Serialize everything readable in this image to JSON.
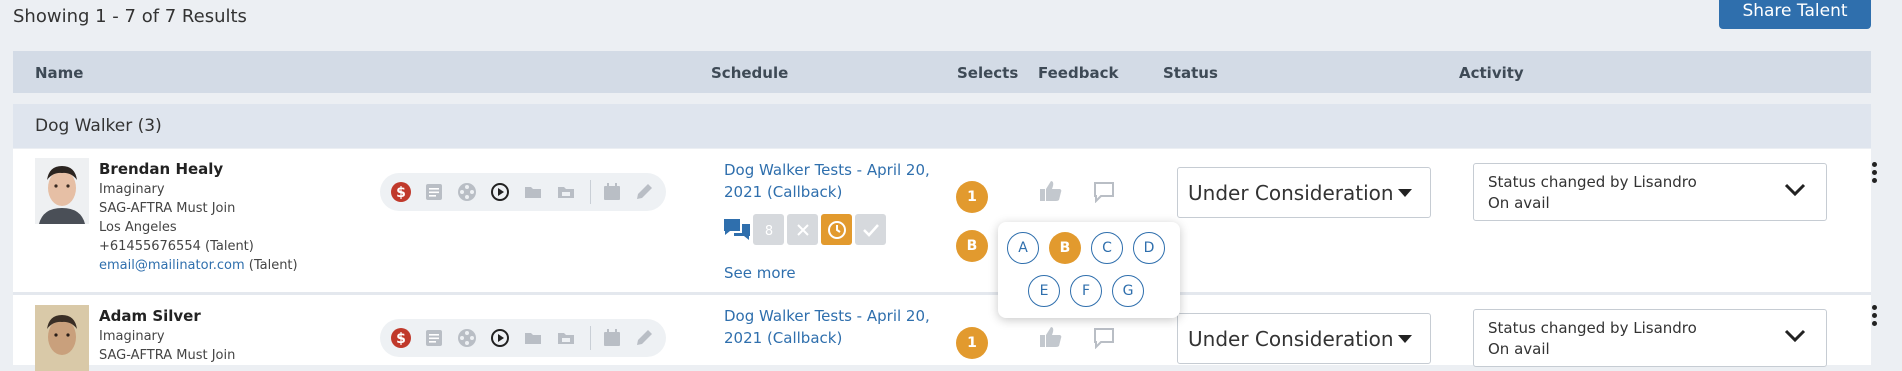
{
  "results_count": "Showing 1 - 7 of 7 Results",
  "share_button": "Share Talent",
  "columns": {
    "name": "Name",
    "schedule": "Schedule",
    "selects": "Selects",
    "feedback": "Feedback",
    "status": "Status",
    "activity": "Activity"
  },
  "group": {
    "title": "Dog Walker (3)"
  },
  "rows": [
    {
      "name": "Brendan Healy",
      "agency": "Imaginary",
      "union": "SAG-AFTRA Must Join",
      "location": "Los Angeles",
      "phone": "+61455676554 (Talent)",
      "email": "email@mailinator.com",
      "email_suffix": " (Talent)",
      "schedule_line1": "Dog Walker Tests - April 20,",
      "schedule_line2": "2021 (Callback)",
      "see_more": "See more",
      "select_number": "1",
      "select_letter": "B",
      "status": "Under Consideration",
      "activity_line1": "Status changed by Lisandro",
      "activity_line2": "On avail"
    },
    {
      "name": "Adam Silver",
      "agency": "Imaginary",
      "union": "SAG-AFTRA Must Join",
      "schedule_line1": "Dog Walker Tests - April 20,",
      "schedule_line2": "2021 (Callback)",
      "select_number": "1",
      "status": "Under Consideration",
      "activity_line1": "Status changed by Lisandro",
      "activity_line2": "On avail"
    }
  ],
  "select_popover": {
    "options_row1": [
      "A",
      "B",
      "C",
      "D"
    ],
    "options_row2": [
      "E",
      "F",
      "G"
    ],
    "selected": "B"
  },
  "icons": {
    "pill_icons": [
      "dollar-icon",
      "resume-icon",
      "film-reel-icon",
      "play-icon",
      "folder-icon",
      "folder-open-icon",
      "calendar-icon",
      "edit-icon"
    ],
    "schedule_actions": [
      "chat-bubbles-icon",
      "number-icon",
      "x-icon",
      "clock-icon",
      "check-icon"
    ],
    "feedback": [
      "thumbs-up-icon",
      "comment-icon"
    ]
  },
  "colors": {
    "accent_blue": "#2f6fad",
    "select_orange": "#e29a2e",
    "dollar_red": "#c0392b"
  }
}
